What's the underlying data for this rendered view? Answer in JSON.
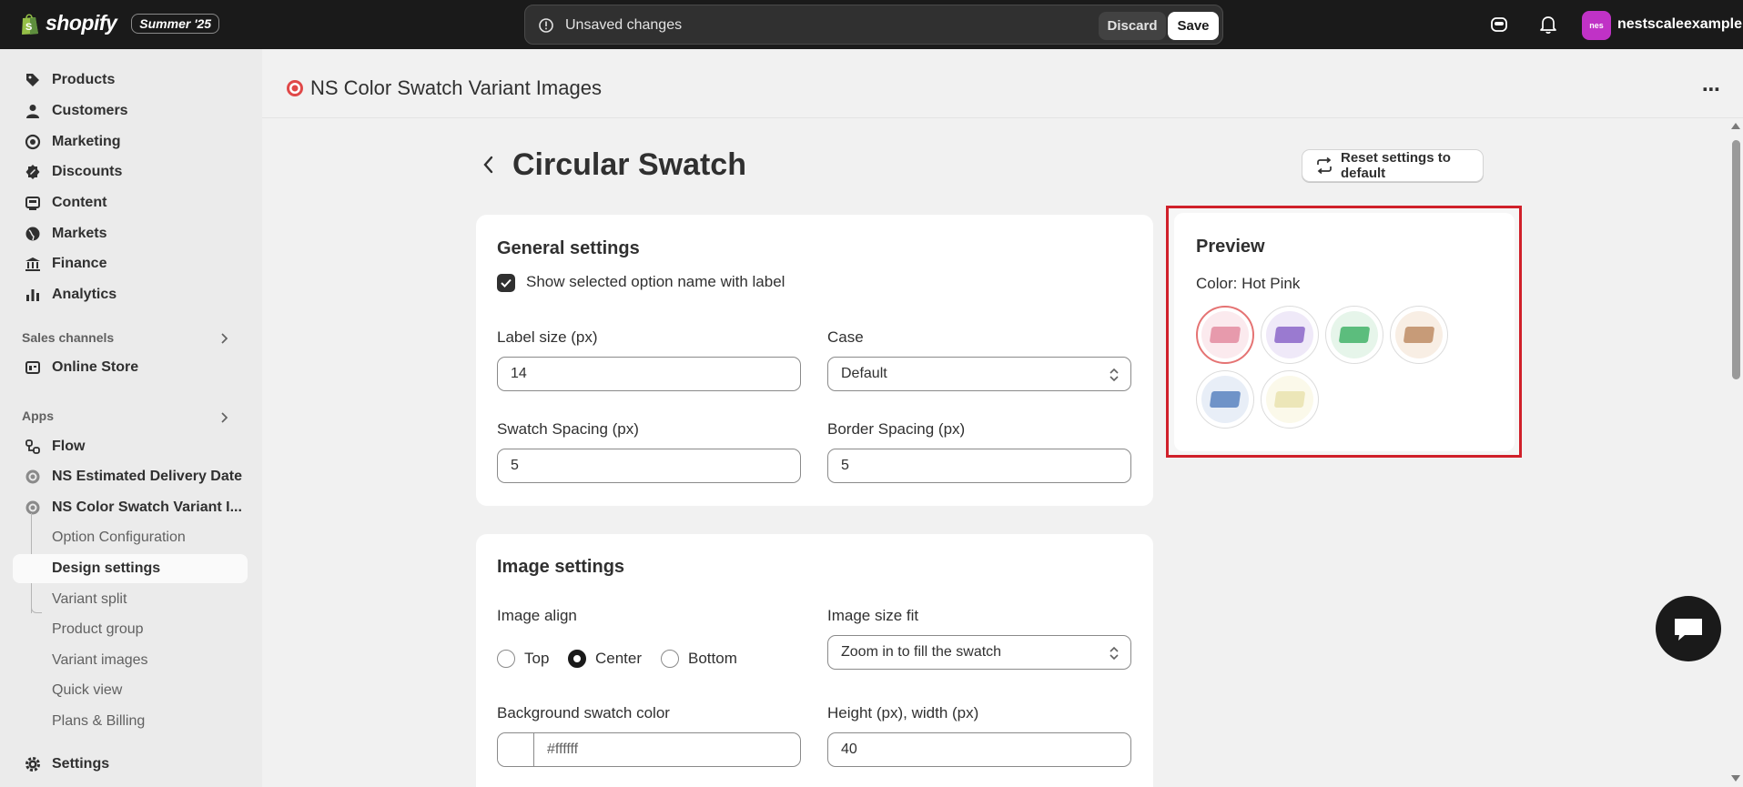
{
  "topbar": {
    "brand": "shopify",
    "edition": "Summer '25",
    "unsaved_message": "Unsaved changes",
    "discard_label": "Discard",
    "save_label": "Save",
    "store_avatar_text": "nes",
    "store_name": "nestscaleexample",
    "avatar_color": "#c032c6"
  },
  "sidebar": {
    "items": [
      {
        "label": "Products",
        "icon": "tag-icon"
      },
      {
        "label": "Customers",
        "icon": "person-icon"
      },
      {
        "label": "Marketing",
        "icon": "target-icon"
      },
      {
        "label": "Discounts",
        "icon": "discount-icon"
      },
      {
        "label": "Content",
        "icon": "content-icon"
      },
      {
        "label": "Markets",
        "icon": "globe-icon"
      },
      {
        "label": "Finance",
        "icon": "bank-icon"
      },
      {
        "label": "Analytics",
        "icon": "bar-chart-icon"
      }
    ],
    "sales_channels_label": "Sales channels",
    "online_store_label": "Online Store",
    "apps_label": "Apps",
    "apps": [
      {
        "label": "Flow",
        "icon": "flow-icon"
      },
      {
        "label": "NS Estimated Delivery Date",
        "icon": "app-target-icon"
      },
      {
        "label": "NS Color Swatch Variant I...",
        "icon": "app-target-icon"
      }
    ],
    "sub_items": [
      "Option Configuration",
      "Design settings",
      "Variant split",
      "Product group",
      "Variant images",
      "Quick view",
      "Plans & Billing"
    ],
    "active_sub": "Design settings",
    "settings_label": "Settings"
  },
  "app_header": {
    "title": "NS Color Swatch Variant Images",
    "menu_glyph": "⋯"
  },
  "page": {
    "title": "Circular Swatch",
    "reset_label": "Reset settings to default"
  },
  "general": {
    "title": "General settings",
    "show_label_text": "Show selected option name with label",
    "show_label_checked": true,
    "label_size_label": "Label size (px)",
    "label_size_value": "14",
    "case_label": "Case",
    "case_value": "Default",
    "swatch_spacing_label": "Swatch Spacing (px)",
    "swatch_spacing_value": "5",
    "border_spacing_label": "Border Spacing (px)",
    "border_spacing_value": "5"
  },
  "image": {
    "title": "Image settings",
    "align_label": "Image align",
    "align_options": [
      "Top",
      "Center",
      "Bottom"
    ],
    "align_selected": "Center",
    "size_fit_label": "Image size fit",
    "size_fit_value": "Zoom in to fill the swatch",
    "bg_color_label": "Background swatch color",
    "bg_color_value": "#ffffff",
    "hw_label": "Height (px), width (px)",
    "hw_value": "40"
  },
  "preview": {
    "title": "Preview",
    "color_text": "Color: Hot Pink",
    "highlight_color": "#d0202a",
    "swatches": [
      {
        "name": "hot-pink",
        "bg": "#fbeaee",
        "pill": "#e79aac",
        "selected": true
      },
      {
        "name": "purple",
        "bg": "#efe9f8",
        "pill": "#9a7ad0",
        "selected": false
      },
      {
        "name": "green",
        "bg": "#e6f5ea",
        "pill": "#5cbd7d",
        "selected": false
      },
      {
        "name": "tan",
        "bg": "#f8eee4",
        "pill": "#c79b78",
        "selected": false
      },
      {
        "name": "blue",
        "bg": "#e8eef7",
        "pill": "#6f93c8",
        "selected": false
      },
      {
        "name": "cream",
        "bg": "#fbf9ea",
        "pill": "#ece6b8",
        "selected": false
      }
    ]
  }
}
